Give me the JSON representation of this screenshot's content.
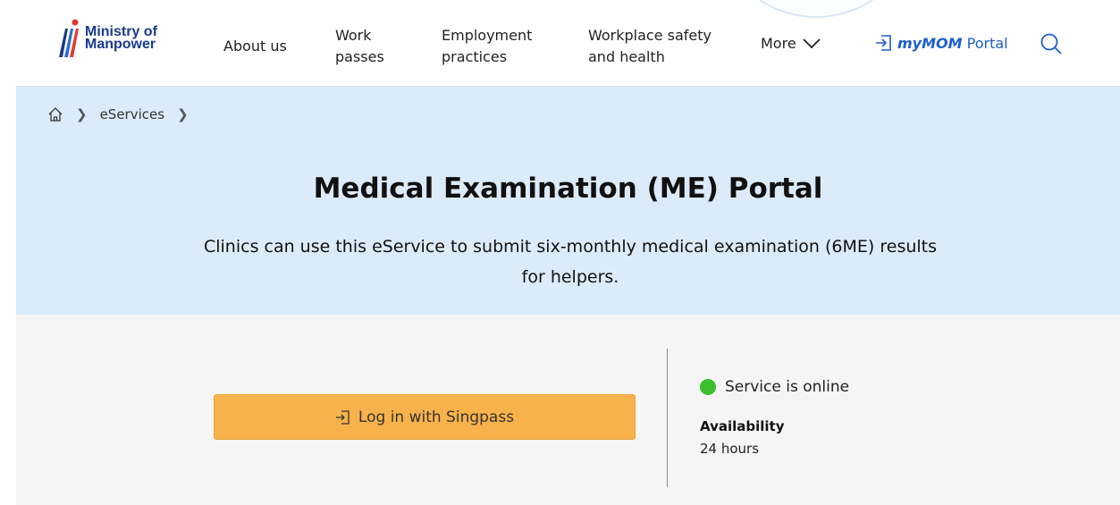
{
  "header": {
    "logo_line1": "Ministry of",
    "logo_line2": "Manpower",
    "nav": [
      {
        "line1": "About us",
        "line2": ""
      },
      {
        "line1": "Work",
        "line2": "passes"
      },
      {
        "line1": "Employment",
        "line2": "practices"
      },
      {
        "line1": "Workplace safety",
        "line2": "and health"
      },
      {
        "line1": "More",
        "line2": ""
      }
    ],
    "portal_label": "myMOM",
    "portal_suffix": "Portal"
  },
  "breadcrumb": {
    "items": [
      "eServices"
    ]
  },
  "hero": {
    "title": "Medical Examination (ME) Portal",
    "subtitle_line1": "Clinics can use this eService to submit six-monthly medical examination (6ME) results",
    "subtitle_line2": "for helpers."
  },
  "service": {
    "login_label": "Log in with Singpass",
    "status_text": "Service is online",
    "status_color": "#3cbf2c",
    "availability_label": "Availability",
    "availability_value": "24 hours"
  },
  "colors": {
    "brand": "#1b3a8c",
    "accent_blue": "#1d5fcc",
    "hero_bg": "#dcebfa",
    "button_bg": "#f8b24b"
  }
}
